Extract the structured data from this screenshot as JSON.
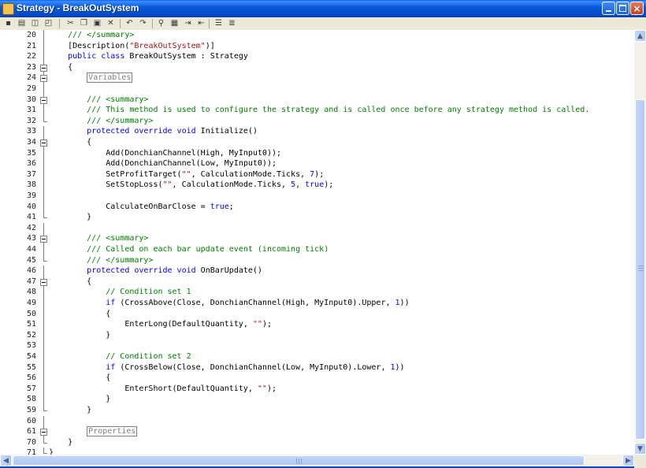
{
  "window": {
    "title": "Strategy - BreakOutSystem",
    "icon": "strategy-document-icon",
    "controls": [
      "minimize-icon",
      "maximize-icon",
      "close-icon"
    ],
    "close_glyph": "×"
  },
  "toolbar": {
    "buttons": [
      {
        "name": "save-icon",
        "glyph": "▪"
      },
      {
        "name": "print-icon",
        "glyph": "▤"
      },
      {
        "name": "print-preview-icon",
        "glyph": "◫"
      },
      {
        "name": "compile-icon",
        "glyph": "◰"
      },
      {
        "name": "cut-icon",
        "glyph": "✂"
      },
      {
        "name": "copy-icon",
        "glyph": "❐"
      },
      {
        "name": "paste-icon",
        "glyph": "▣"
      },
      {
        "name": "delete-icon",
        "glyph": "✕"
      },
      {
        "name": "undo-icon",
        "glyph": "↶"
      },
      {
        "name": "redo-icon",
        "glyph": "↷"
      },
      {
        "name": "find-icon",
        "glyph": "⚲"
      },
      {
        "name": "replace-icon",
        "glyph": "▦"
      },
      {
        "name": "indent-icon",
        "glyph": "⇥"
      },
      {
        "name": "outdent-icon",
        "glyph": "⇤"
      },
      {
        "name": "comment-icon",
        "glyph": "☰"
      },
      {
        "name": "uncomment-icon",
        "glyph": "≣"
      }
    ]
  },
  "editor": {
    "lines": [
      {
        "num": "20",
        "fold": "line",
        "parts": [
          {
            "t": "    /// </summary>",
            "c": "cm"
          }
        ]
      },
      {
        "num": "21",
        "fold": "line",
        "parts": [
          {
            "t": "    [Description(",
            "c": ""
          },
          {
            "t": "\"BreakOutSystem\"",
            "c": "st"
          },
          {
            "t": ")]",
            "c": ""
          }
        ]
      },
      {
        "num": "22",
        "fold": "line",
        "parts": [
          {
            "t": "    ",
            "c": ""
          },
          {
            "t": "public class",
            "c": "kw"
          },
          {
            "t": " BreakOutSystem : Strategy",
            "c": ""
          }
        ]
      },
      {
        "num": "23",
        "fold": "box",
        "parts": [
          {
            "t": "    {",
            "c": ""
          }
        ]
      },
      {
        "num": "24",
        "fold": "box",
        "parts": [
          {
            "t": "        ",
            "c": ""
          },
          {
            "t": "Variables",
            "c": "region"
          }
        ]
      },
      {
        "num": "29",
        "fold": "line",
        "parts": []
      },
      {
        "num": "30",
        "fold": "box",
        "parts": [
          {
            "t": "        /// <summary>",
            "c": "cm"
          }
        ]
      },
      {
        "num": "31",
        "fold": "line",
        "parts": [
          {
            "t": "        /// This method is used to configure the strategy and is called once before any strategy method is called.",
            "c": "cm"
          }
        ]
      },
      {
        "num": "32",
        "fold": "end",
        "parts": [
          {
            "t": "        /// </summary>",
            "c": "cm"
          }
        ]
      },
      {
        "num": "33",
        "fold": "line",
        "parts": [
          {
            "t": "        ",
            "c": ""
          },
          {
            "t": "protected override void",
            "c": "kw"
          },
          {
            "t": " Initialize()",
            "c": ""
          }
        ]
      },
      {
        "num": "34",
        "fold": "box",
        "parts": [
          {
            "t": "        {",
            "c": ""
          }
        ]
      },
      {
        "num": "35",
        "fold": "line",
        "parts": [
          {
            "t": "            Add(DonchianChannel(High, MyInput0));",
            "c": ""
          }
        ]
      },
      {
        "num": "36",
        "fold": "line",
        "parts": [
          {
            "t": "            Add(DonchianChannel(Low, MyInput0));",
            "c": ""
          }
        ]
      },
      {
        "num": "37",
        "fold": "line",
        "parts": [
          {
            "t": "            SetProfitTarget(",
            "c": ""
          },
          {
            "t": "\"\"",
            "c": "st"
          },
          {
            "t": ", CalculationMode.Ticks, ",
            "c": ""
          },
          {
            "t": "7",
            "c": "kw"
          },
          {
            "t": ");",
            "c": ""
          }
        ]
      },
      {
        "num": "38",
        "fold": "line",
        "parts": [
          {
            "t": "            SetStopLoss(",
            "c": ""
          },
          {
            "t": "\"\"",
            "c": "st"
          },
          {
            "t": ", CalculationMode.Ticks, ",
            "c": ""
          },
          {
            "t": "5",
            "c": "kw"
          },
          {
            "t": ", ",
            "c": ""
          },
          {
            "t": "true",
            "c": "kw"
          },
          {
            "t": ");",
            "c": ""
          }
        ]
      },
      {
        "num": "39",
        "fold": "line",
        "parts": []
      },
      {
        "num": "40",
        "fold": "line",
        "parts": [
          {
            "t": "            CalculateOnBarClose = ",
            "c": ""
          },
          {
            "t": "true",
            "c": "kw"
          },
          {
            "t": ";",
            "c": ""
          }
        ]
      },
      {
        "num": "41",
        "fold": "end",
        "parts": [
          {
            "t": "        }",
            "c": ""
          }
        ]
      },
      {
        "num": "42",
        "fold": "line",
        "parts": []
      },
      {
        "num": "43",
        "fold": "box",
        "parts": [
          {
            "t": "        /// <summary>",
            "c": "cm"
          }
        ]
      },
      {
        "num": "44",
        "fold": "line",
        "parts": [
          {
            "t": "        /// Called on each bar update event (incoming tick)",
            "c": "cm"
          }
        ]
      },
      {
        "num": "45",
        "fold": "end",
        "parts": [
          {
            "t": "        /// </summary>",
            "c": "cm"
          }
        ]
      },
      {
        "num": "46",
        "fold": "line",
        "parts": [
          {
            "t": "        ",
            "c": ""
          },
          {
            "t": "protected override void",
            "c": "kw"
          },
          {
            "t": " OnBarUpdate()",
            "c": ""
          }
        ]
      },
      {
        "num": "47",
        "fold": "box",
        "parts": [
          {
            "t": "        {",
            "c": ""
          }
        ]
      },
      {
        "num": "48",
        "fold": "line",
        "parts": [
          {
            "t": "            // Condition set 1",
            "c": "cm"
          }
        ]
      },
      {
        "num": "49",
        "fold": "line",
        "parts": [
          {
            "t": "            ",
            "c": ""
          },
          {
            "t": "if",
            "c": "kw"
          },
          {
            "t": " (CrossAbove(Close, DonchianChannel(High, MyInput0).Upper, ",
            "c": ""
          },
          {
            "t": "1",
            "c": "kw"
          },
          {
            "t": "))",
            "c": ""
          }
        ]
      },
      {
        "num": "50",
        "fold": "line",
        "parts": [
          {
            "t": "            {",
            "c": ""
          }
        ]
      },
      {
        "num": "51",
        "fold": "line",
        "parts": [
          {
            "t": "                EnterLong(DefaultQuantity, ",
            "c": ""
          },
          {
            "t": "\"\"",
            "c": "st"
          },
          {
            "t": ");",
            "c": ""
          }
        ]
      },
      {
        "num": "52",
        "fold": "line",
        "parts": [
          {
            "t": "            }",
            "c": ""
          }
        ]
      },
      {
        "num": "53",
        "fold": "line",
        "parts": []
      },
      {
        "num": "54",
        "fold": "line",
        "parts": [
          {
            "t": "            // Condition set 2",
            "c": "cm"
          }
        ]
      },
      {
        "num": "55",
        "fold": "line",
        "parts": [
          {
            "t": "            ",
            "c": ""
          },
          {
            "t": "if",
            "c": "kw"
          },
          {
            "t": " (CrossBelow(Close, DonchianChannel(Low, MyInput0).Lower, ",
            "c": ""
          },
          {
            "t": "1",
            "c": "kw"
          },
          {
            "t": "))",
            "c": ""
          }
        ]
      },
      {
        "num": "56",
        "fold": "line",
        "parts": [
          {
            "t": "            {",
            "c": ""
          }
        ]
      },
      {
        "num": "57",
        "fold": "line",
        "parts": [
          {
            "t": "                EnterShort(DefaultQuantity, ",
            "c": ""
          },
          {
            "t": "\"\"",
            "c": "st"
          },
          {
            "t": ");",
            "c": ""
          }
        ]
      },
      {
        "num": "58",
        "fold": "line",
        "parts": [
          {
            "t": "            }",
            "c": ""
          }
        ]
      },
      {
        "num": "59",
        "fold": "end",
        "parts": [
          {
            "t": "        }",
            "c": ""
          }
        ]
      },
      {
        "num": "60",
        "fold": "line",
        "parts": []
      },
      {
        "num": "61",
        "fold": "box",
        "parts": [
          {
            "t": "        ",
            "c": ""
          },
          {
            "t": "Properties",
            "c": "region"
          }
        ]
      },
      {
        "num": "70",
        "fold": "end",
        "parts": [
          {
            "t": "    }",
            "c": ""
          }
        ]
      },
      {
        "num": "71",
        "fold": "end",
        "parts": [
          {
            "t": "}",
            "c": ""
          }
        ]
      }
    ]
  },
  "scrollbars": {
    "vertical": {
      "up_glyph": "▲",
      "down_glyph": "▼"
    },
    "horizontal": {
      "left_glyph": "◀",
      "right_glyph": "▶"
    }
  },
  "colors": {
    "keyword": "#0000ff",
    "comment": "#008000",
    "string": "#a31515",
    "region": "#808080",
    "titlebar": "#0a5ad8"
  }
}
